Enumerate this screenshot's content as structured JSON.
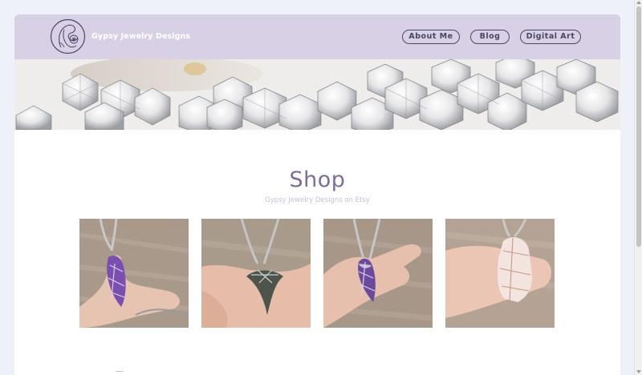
{
  "header": {
    "brand": "Gypsy Jewelry Designs",
    "nav": {
      "about": "About Me",
      "blog": "Blog",
      "digital_art": "Digital Art"
    }
  },
  "shop": {
    "title": "Shop",
    "subtitle": "Gypsy Jewelry Designs on Etsy"
  },
  "products": [
    {
      "name": "amethyst-wire-wrapped-pendant",
      "icon": "pendant-photo",
      "stone_color": "#7a4fb0"
    },
    {
      "name": "shark-tooth-wire-wrapped-pendant",
      "icon": "pendant-photo",
      "stone_color": "#4c544c"
    },
    {
      "name": "amethyst-point-wire-wrapped-pendant",
      "icon": "pendant-photo",
      "stone_color": "#6b4a9e"
    },
    {
      "name": "rose-quartz-wire-wrapped-pendant",
      "icon": "pendant-photo",
      "stone_color": "#f3e4df"
    }
  ],
  "colors": {
    "header_bg": "#d8d1e6",
    "nav_border": "#4a4562",
    "title": "#7c6d99",
    "subtitle": "#c7bedb",
    "page_bg": "#eef1f8"
  }
}
